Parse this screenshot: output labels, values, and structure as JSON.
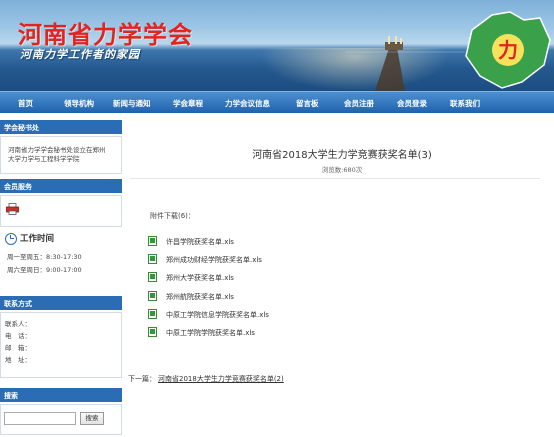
{
  "banner": {
    "title": "河南省力学学会",
    "subtitle": "河南力学工作者的家园"
  },
  "nav": {
    "items": [
      "首页",
      "领导机构",
      "新闻与通知",
      "学会章程",
      "力学会议信息",
      "留言板",
      "会员注册",
      "会员登录",
      "联系我们"
    ]
  },
  "sidebar": {
    "secretariat": {
      "heading": "学会秘书处",
      "lines": [
        "河南省力学学会秘书处设立在郑州",
        "大学力学与工程科学学院"
      ]
    },
    "member_service": {
      "heading": "会员服务"
    },
    "work_hours": {
      "heading": "工作时间",
      "lines": [
        "周一至周五：8:30-17:30",
        "周六至周日：9:00-17:00"
      ]
    },
    "contact": {
      "heading": "联系方式",
      "fields": [
        "联系人：",
        "电　话：",
        "邮　箱：",
        "地　址："
      ]
    },
    "search": {
      "heading": "搜索",
      "button": "搜索",
      "value": ""
    }
  },
  "article": {
    "title": "河南省2018大学生力学竞赛获奖名单(3)",
    "views": "浏览数:680次",
    "attachments_label": "附件下载(6)：",
    "attachments": [
      "许昌学院获奖名单.xls",
      "郑州成功财经学院获奖名单.xls",
      "郑州大学获奖名单.xls",
      "郑州航院获奖名单.xls",
      "中原工学院信息学院获奖名单.xls",
      "中原工学院学院获奖名单.xls"
    ],
    "prev_label": "下一篇：",
    "prev_link": "河南省2018大学生力学竞赛获奖名单(2)"
  },
  "colors": {
    "accent": "#2a6db4",
    "title_red": "#e3241e"
  }
}
